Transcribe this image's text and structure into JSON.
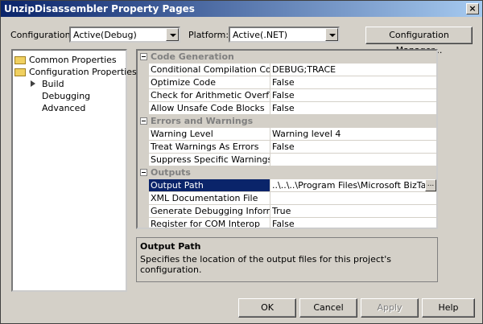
{
  "window": {
    "title": "UnzipDisassembler Property Pages",
    "close_symbol": "×"
  },
  "configuration": {
    "label": "Configuration:",
    "value": "Active(Debug)"
  },
  "platform": {
    "label": "Platform:",
    "value": "Active(.NET)"
  },
  "configuration_manager_label": "Configuration Manager...",
  "tree": {
    "common": "Common Properties",
    "config": "Configuration Properties",
    "children": [
      "Build",
      "Debugging",
      "Advanced"
    ]
  },
  "grid": {
    "categories": [
      {
        "name": "Code Generation",
        "rows": [
          {
            "name": "Conditional Compilation Constant",
            "value": "DEBUG;TRACE"
          },
          {
            "name": "Optimize Code",
            "value": "False"
          },
          {
            "name": "Check for Arithmetic Overflow/Ur",
            "value": "False"
          },
          {
            "name": "Allow Unsafe Code Blocks",
            "value": "False"
          }
        ]
      },
      {
        "name": "Errors and Warnings",
        "rows": [
          {
            "name": "Warning Level",
            "value": "Warning level 4"
          },
          {
            "name": "Treat Warnings As Errors",
            "value": "False"
          },
          {
            "name": "Suppress Specific Warnings",
            "value": ""
          }
        ]
      },
      {
        "name": "Outputs",
        "rows": [
          {
            "name": "Output Path",
            "value": "..\\..\\..\\Program Files\\Microsoft BizTalk Serv"
          },
          {
            "name": "XML Documentation File",
            "value": ""
          },
          {
            "name": "Generate Debugging Information",
            "value": "True"
          },
          {
            "name": "Register for COM Interop",
            "value": "False"
          }
        ]
      }
    ],
    "ellipsis": "..."
  },
  "description": {
    "title": "Output Path",
    "text": "Specifies the location of the output files for this project's configuration."
  },
  "buttons": {
    "ok": "OK",
    "cancel": "Cancel",
    "apply": "Apply",
    "help": "Help"
  }
}
